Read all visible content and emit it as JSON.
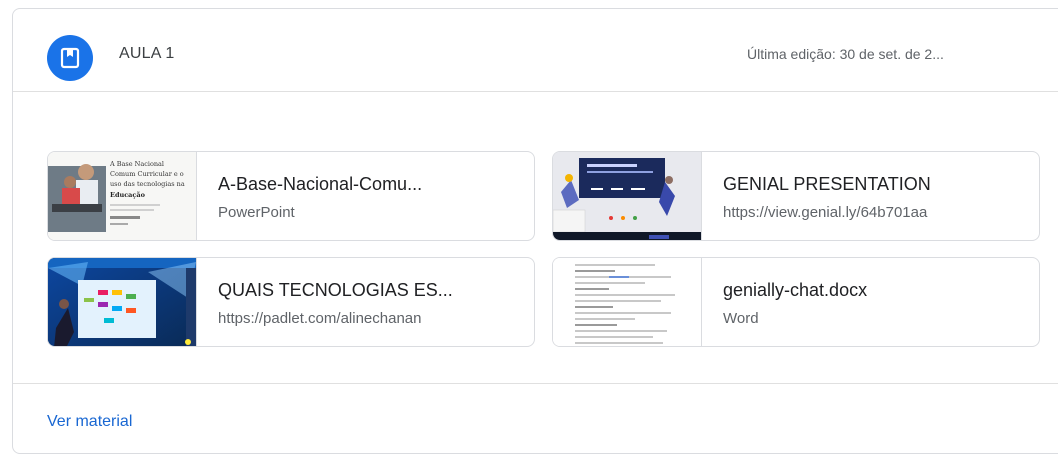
{
  "header": {
    "icon": "bookmark-icon",
    "title": "AULA 1",
    "meta": "Última edição: 30 de set. de 2..."
  },
  "attachments": [
    {
      "title": "A-Base-Nacional-Comu...",
      "subtitle": "PowerPoint",
      "thumb_text": [
        "A Base Nacional",
        "Comum Curricular e o",
        "uso das tecnologias na",
        "Educação"
      ]
    },
    {
      "title": "GENIAL PRESENTATION",
      "subtitle": "https://view.genial.ly/64b701aa"
    },
    {
      "title": "QUAIS TECNOLOGIAS ES...",
      "subtitle": "https://padlet.com/alinechanan"
    },
    {
      "title": "genially-chat.docx",
      "subtitle": "Word"
    }
  ],
  "footer": {
    "link_label": "Ver material"
  },
  "colors": {
    "accent": "#1a73e8",
    "link": "#1967d2",
    "border": "#dadce0"
  }
}
